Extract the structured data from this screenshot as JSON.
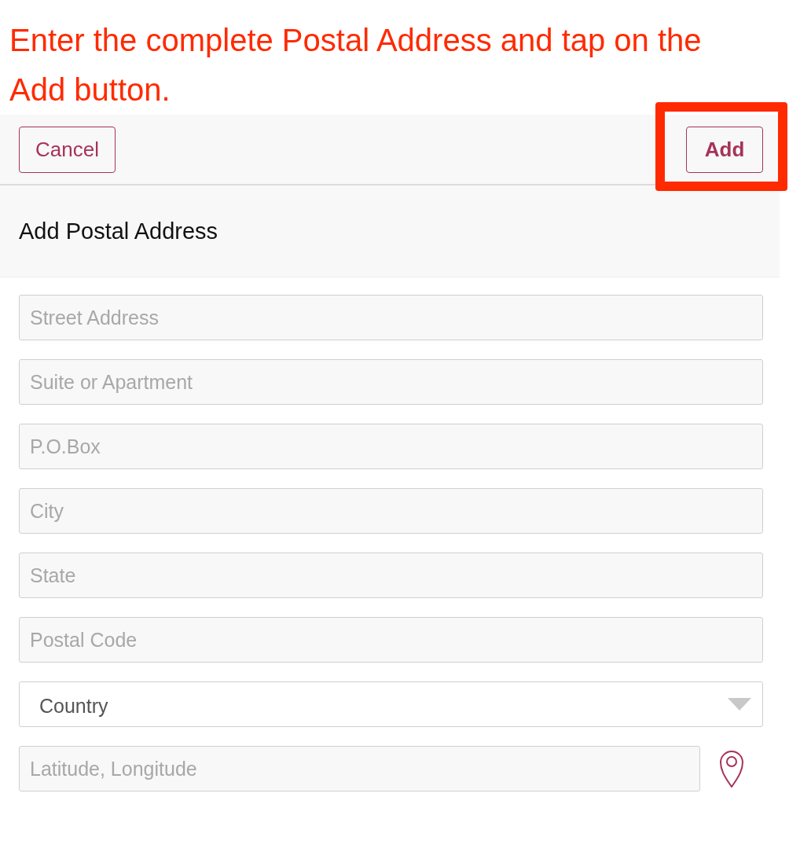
{
  "instruction": "Enter the complete Postal Address and tap on the Add button.",
  "header": {
    "cancel_button": "Cancel",
    "add_button": {
      "label": "Add",
      "highlighted": true
    }
  },
  "title": "Add Postal Address",
  "fields": [
    {
      "kind": "text",
      "placeholder": "Street Address"
    },
    {
      "kind": "text",
      "placeholder": "Suite or Apartment"
    },
    {
      "kind": "text",
      "placeholder": "P.O.Box"
    },
    {
      "kind": "text",
      "placeholder": "City"
    },
    {
      "kind": "text",
      "placeholder": "State"
    },
    {
      "kind": "text",
      "placeholder": "Postal Code"
    },
    {
      "kind": "select",
      "value": "Country"
    },
    {
      "kind": "location",
      "placeholder": "Latitude, Longitude"
    }
  ]
}
